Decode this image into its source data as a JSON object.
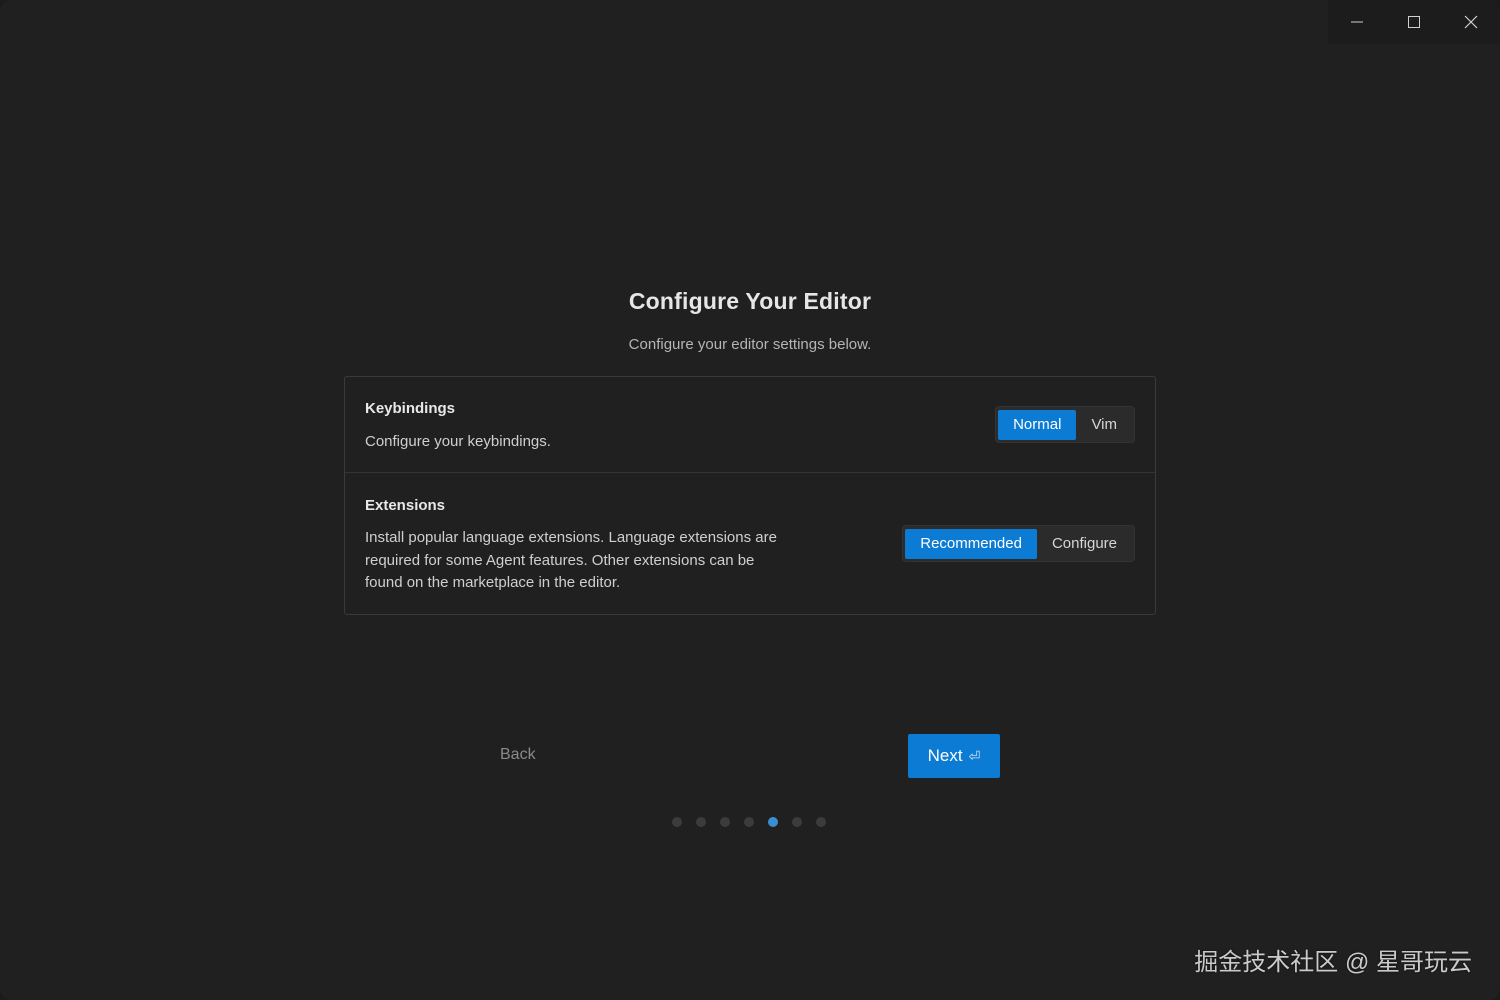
{
  "window_controls": {
    "minimize_icon": "minimize-icon",
    "maximize_icon": "maximize-icon",
    "close_icon": "close-icon"
  },
  "header": {
    "title": "Configure Your Editor",
    "subtitle": "Configure your editor settings below."
  },
  "settings": {
    "keybindings": {
      "title": "Keybindings",
      "description": "Configure your keybindings.",
      "options": [
        "Normal",
        "Vim"
      ],
      "selected": "Normal"
    },
    "extensions": {
      "title": "Extensions",
      "description_lines": [
        "Install popular language extensions. Language extensions are",
        "required for some Agent features. Other extensions can be",
        "found on the marketplace in the editor."
      ],
      "options": [
        "Recommended",
        "Configure"
      ],
      "selected": "Recommended"
    }
  },
  "navigation": {
    "back_label": "Back",
    "next_label": "Next",
    "next_icon": "⏎"
  },
  "progress": {
    "total_steps": 7,
    "current_step": 5
  },
  "watermark": "掘金技术社区 @ 星哥玩云",
  "colors": {
    "accent": "#0c7bd4",
    "background": "#202020",
    "active_dot": "#3a8fd0"
  }
}
